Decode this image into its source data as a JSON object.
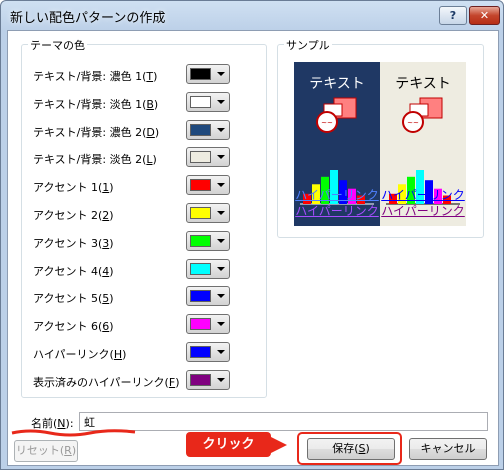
{
  "window": {
    "title": "新しい配色パターンの作成",
    "help_label": "?",
    "close_label": "✕"
  },
  "theme_colors": {
    "group_label": "テーマの色",
    "items": [
      {
        "label": "テキスト/背景: 濃色 1(",
        "key": "T",
        "color": "#000000"
      },
      {
        "label": "テキスト/背景: 淡色 1(",
        "key": "B",
        "color": "#ffffff"
      },
      {
        "label": "テキスト/背景: 濃色 2(",
        "key": "D",
        "color": "#1f497d"
      },
      {
        "label": "テキスト/背景: 淡色 2(",
        "key": "L",
        "color": "#eeece1"
      },
      {
        "label": "アクセント 1(",
        "key": "1",
        "color": "#ff0000"
      },
      {
        "label": "アクセント 2(",
        "key": "2",
        "color": "#ffff00"
      },
      {
        "label": "アクセント 3(",
        "key": "3",
        "color": "#00ff00"
      },
      {
        "label": "アクセント 4(",
        "key": "4",
        "color": "#00ffff"
      },
      {
        "label": "アクセント 5(",
        "key": "5",
        "color": "#0000ff"
      },
      {
        "label": "アクセント 6(",
        "key": "6",
        "color": "#ff00ff"
      },
      {
        "label": "ハイパーリンク(",
        "key": "H",
        "color": "#0000ff"
      },
      {
        "label": "表示済みのハイパーリンク(",
        "key": "F",
        "color": "#800080"
      }
    ]
  },
  "sample": {
    "group_label": "サンプル",
    "text_label": "テキスト",
    "hyperlink": "ハイパーリンク",
    "visited_hyperlink": "ハイパーリンク",
    "bar_values": [
      0.3,
      0.58,
      0.8,
      1.0,
      0.7,
      0.45,
      0.25
    ]
  },
  "name": {
    "label": "名前(",
    "key": "N",
    "value": "虹"
  },
  "buttons": {
    "reset_label": "リセット(",
    "reset_key": "R",
    "save_label": "保存(",
    "save_key": "S",
    "cancel_label": "キャンセル"
  },
  "annotation": {
    "callout_text": "クリック",
    "accent": "#e8281a"
  }
}
